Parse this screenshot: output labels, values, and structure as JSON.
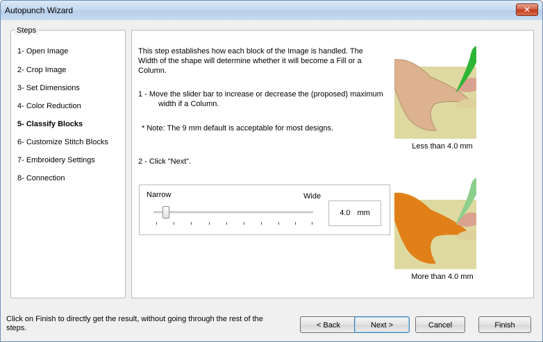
{
  "window": {
    "title": "Autopunch Wizard",
    "close_glyph": "✕"
  },
  "steps": {
    "legend": "Steps",
    "items": [
      {
        "label": "1- Open Image"
      },
      {
        "label": "2- Crop Image"
      },
      {
        "label": "3- Set Dimensions"
      },
      {
        "label": "4- Color Reduction"
      },
      {
        "label": "5- Classify Blocks",
        "active": true
      },
      {
        "label": "6- Customize Stitch Blocks"
      },
      {
        "label": "7- Embroidery Settings"
      },
      {
        "label": "8- Connection"
      }
    ]
  },
  "main": {
    "intro": "This step establishes how each block of the Image is handled. The Width of the shape will determine whether it will become a Fill or a Column.",
    "step1": "1 -  Move the slider bar to increase or decrease the (proposed) maximum width if a Column.",
    "note": "* Note: The 9 mm default is acceptable for most designs.",
    "step2": "2 -  Click \"Next\".",
    "slider": {
      "narrow_label": "Narrow",
      "wide_label": "Wide",
      "value": "4.0",
      "unit": "mm",
      "position_fraction": 0.08
    },
    "preview_top_caption": "Less than 4.0 mm",
    "preview_bottom_caption": "More than 4.0 mm"
  },
  "footer": {
    "hint": "Click on Finish to directly get the result, without going through the rest of the steps.",
    "back_label": "< Back",
    "next_label": "Next >",
    "cancel_label": "Cancel",
    "finish_label": "Finish"
  },
  "colors": {
    "tan": "#ddb28e",
    "sand": "#ded9a0",
    "green": "#2fb536",
    "light_green": "#8ccf8c",
    "pink": "#d9a28e",
    "orange_stitch": "#e9861c"
  }
}
